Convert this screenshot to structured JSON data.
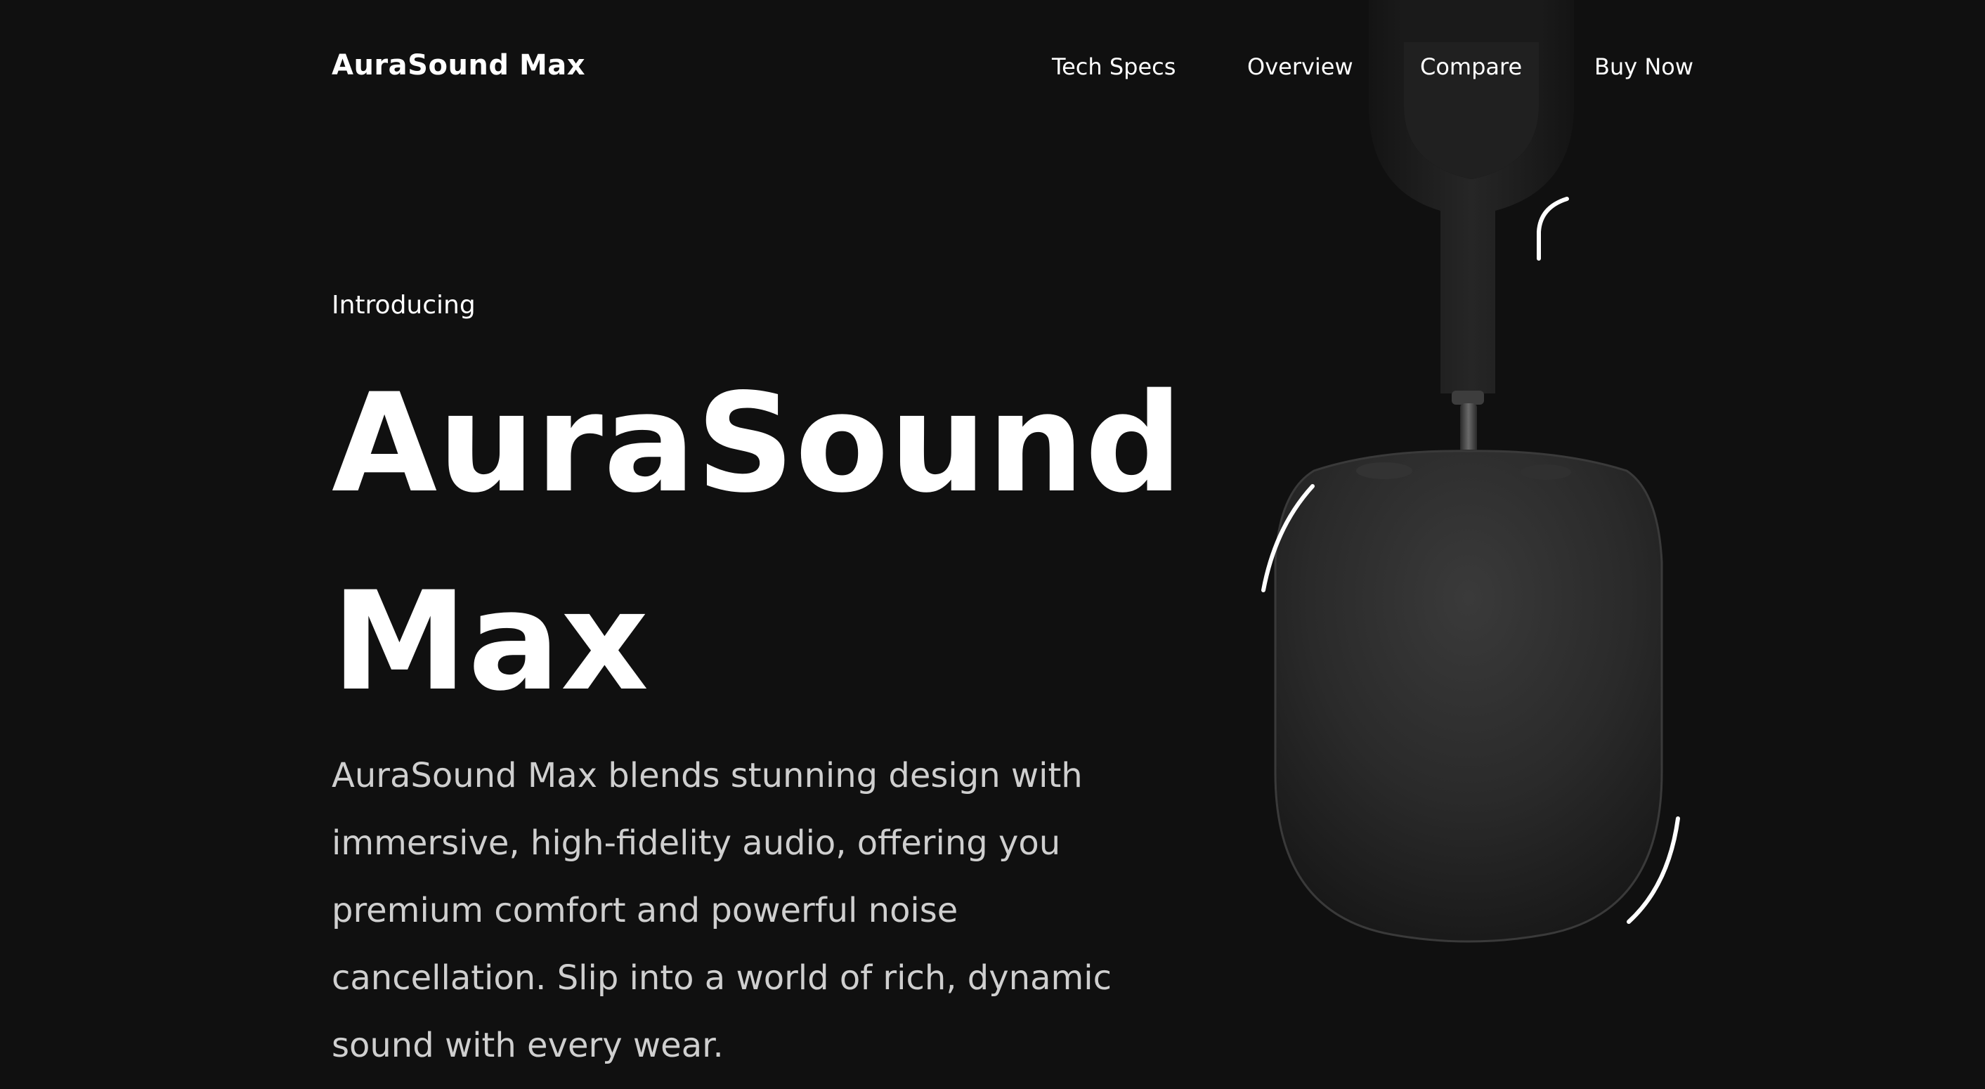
{
  "header": {
    "brand": "AuraSound Max",
    "nav": [
      {
        "label": "Tech Specs"
      },
      {
        "label": "Overview"
      },
      {
        "label": "Compare"
      },
      {
        "label": "Buy Now"
      }
    ]
  },
  "hero": {
    "eyebrow": "Introducing",
    "headline_line1": "AuraSound",
    "headline_line2": "Max",
    "description": "AuraSound Max blends stunning design with immersive, high-fidelity audio, offering you premium comfort and powerful noise cancellation. Slip into a world of rich, dynamic sound with every wear."
  },
  "product_image": {
    "icon": "headphones-icon",
    "colors": {
      "background": "#101010",
      "earcup": "#2b2b2b",
      "headband": "#1c1c1c",
      "motion_lines": "#ffffff"
    }
  }
}
